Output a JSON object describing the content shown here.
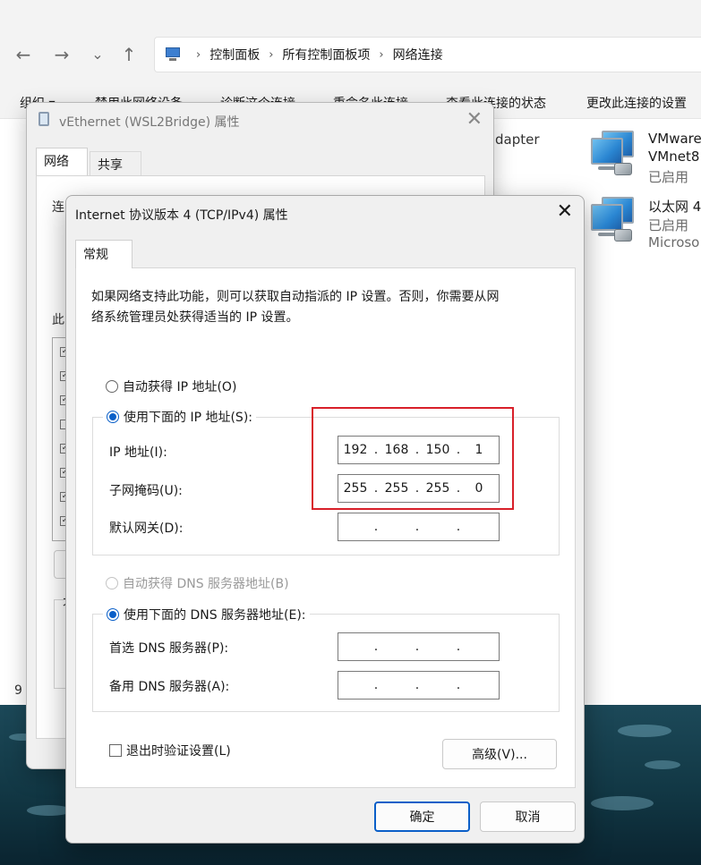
{
  "explorer": {
    "nav": {
      "back": "←",
      "forward": "→",
      "recent": "⌄",
      "up": "↑"
    },
    "breadcrumb": [
      "控制面板",
      "所有控制面板项",
      "网络连接"
    ],
    "commands": [
      "组织 ▾",
      "禁用此网络设备",
      "诊断这个连接",
      "重命名此连接",
      "查看此连接的状态",
      "更改此连接的设置"
    ],
    "adapters": [
      {
        "name": "VMware",
        "device": "VMnet8",
        "status": "已启用"
      },
      {
        "name": "以太网 4",
        "device": "Microso",
        "status": "已启用"
      }
    ],
    "partial_adapter_text": "dapter",
    "left_fragments": {
      "item_count": "9"
    }
  },
  "veth_dialog": {
    "title": "vEthernet (WSL2Bridge) 属性",
    "tabs": [
      "网络",
      "共享"
    ],
    "connect_label": "连",
    "this_label": "此",
    "bottom_label": "才",
    "close": "✕"
  },
  "ipv4_dialog": {
    "title": "Internet 协议版本 4 (TCP/IPv4) 属性",
    "close": "✕",
    "tab": "常规",
    "description_line1": "如果网络支持此功能，则可以获取自动指派的 IP 设置。否则，你需要从网",
    "description_line2": "络系统管理员处获得适当的 IP 设置。",
    "auto_ip_label": "自动获得 IP 地址(O)",
    "manual_ip_label": "使用下面的 IP 地址(S):",
    "ip_label": "IP 地址(I):",
    "ip_value": [
      "192",
      "168",
      "150",
      "1"
    ],
    "mask_label": "子网掩码(U):",
    "mask_value": [
      "255",
      "255",
      "255",
      "0"
    ],
    "gateway_label": "默认网关(D):",
    "gateway_value": [
      "",
      "",
      "",
      ""
    ],
    "auto_dns_label": "自动获得 DNS 服务器地址(B)",
    "manual_dns_label": "使用下面的 DNS 服务器地址(E):",
    "preferred_dns_label": "首选 DNS 服务器(P):",
    "preferred_dns_value": [
      "",
      "",
      "",
      ""
    ],
    "alternate_dns_label": "备用 DNS 服务器(A):",
    "alternate_dns_value": [
      "",
      "",
      "",
      ""
    ],
    "validate_label": "退出时验证设置(L)",
    "advanced_button": "高级(V)...",
    "ok_button": "确定",
    "cancel_button": "取消",
    "auto_ip_selected": false,
    "manual_ip_selected": true,
    "auto_dns_enabled": false,
    "manual_dns_selected": true,
    "validate_checked": false
  },
  "colors": {
    "accent": "#0a5fc8",
    "highlight_box": "#d8202a"
  }
}
